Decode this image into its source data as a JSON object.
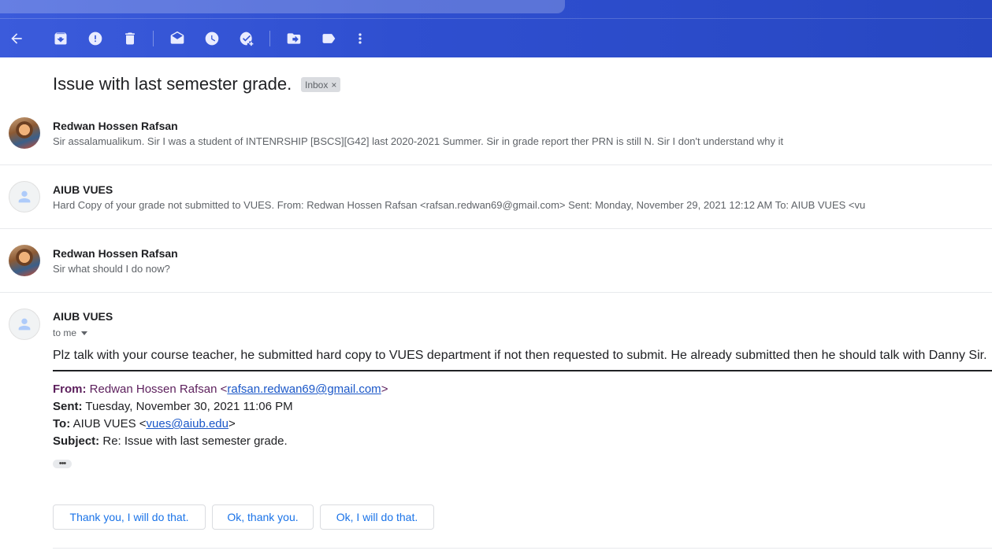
{
  "toolbar": {
    "icons": [
      "back-arrow-icon",
      "archive-icon",
      "report-spam-icon",
      "delete-icon",
      "mark-unread-icon",
      "snooze-icon",
      "add-to-tasks-icon",
      "move-to-icon",
      "label-icon",
      "more-vert-icon"
    ]
  },
  "thread": {
    "subject": "Issue with last semester grade.",
    "label": "Inbox",
    "label_close": "×"
  },
  "messages": [
    {
      "sender": "Redwan Hossen Rafsan",
      "snippet": "Sir assalamualikum. Sir I was a student of INTENRSHIP [BSCS][G42] last 2020-2021 Summer. Sir in grade report ther PRN is still N. Sir I don't understand why it"
    },
    {
      "sender": "AIUB VUES",
      "snippet": "Hard Copy of your grade not submitted to VUES. From: Redwan Hossen Rafsan <rafsan.redwan69@gmail.com> Sent: Monday, November 29, 2021 12:12 AM To: AIUB VUES <vu"
    },
    {
      "sender": "Redwan Hossen Rafsan",
      "snippet": "Sir what should I do now?"
    }
  ],
  "open_message": {
    "sender": "AIUB VUES",
    "to": "to me",
    "body": "Plz talk with your course teacher, he submitted hard copy to VUES department if not then requested to submit. He already submitted then he should talk with Danny Sir.",
    "quoted": {
      "from_label": "From:",
      "from_name": "Redwan Hossen Rafsan <",
      "from_email": "rafsan.redwan69@gmail.com",
      "from_close": ">",
      "sent_label": "Sent:",
      "sent_value": "Tuesday, November 30, 2021 11:06 PM",
      "to_label": "To:",
      "to_name": "AIUB VUES <",
      "to_email": "vues@aiub.edu",
      "to_close": ">",
      "subject_label": "Subject:",
      "subject_value": "Re: Issue with last semester grade."
    },
    "ellipsis": "•••"
  },
  "smart_replies": [
    "Thank you, I will do that.",
    "Ok, thank you.",
    "Ok, I will do that."
  ]
}
